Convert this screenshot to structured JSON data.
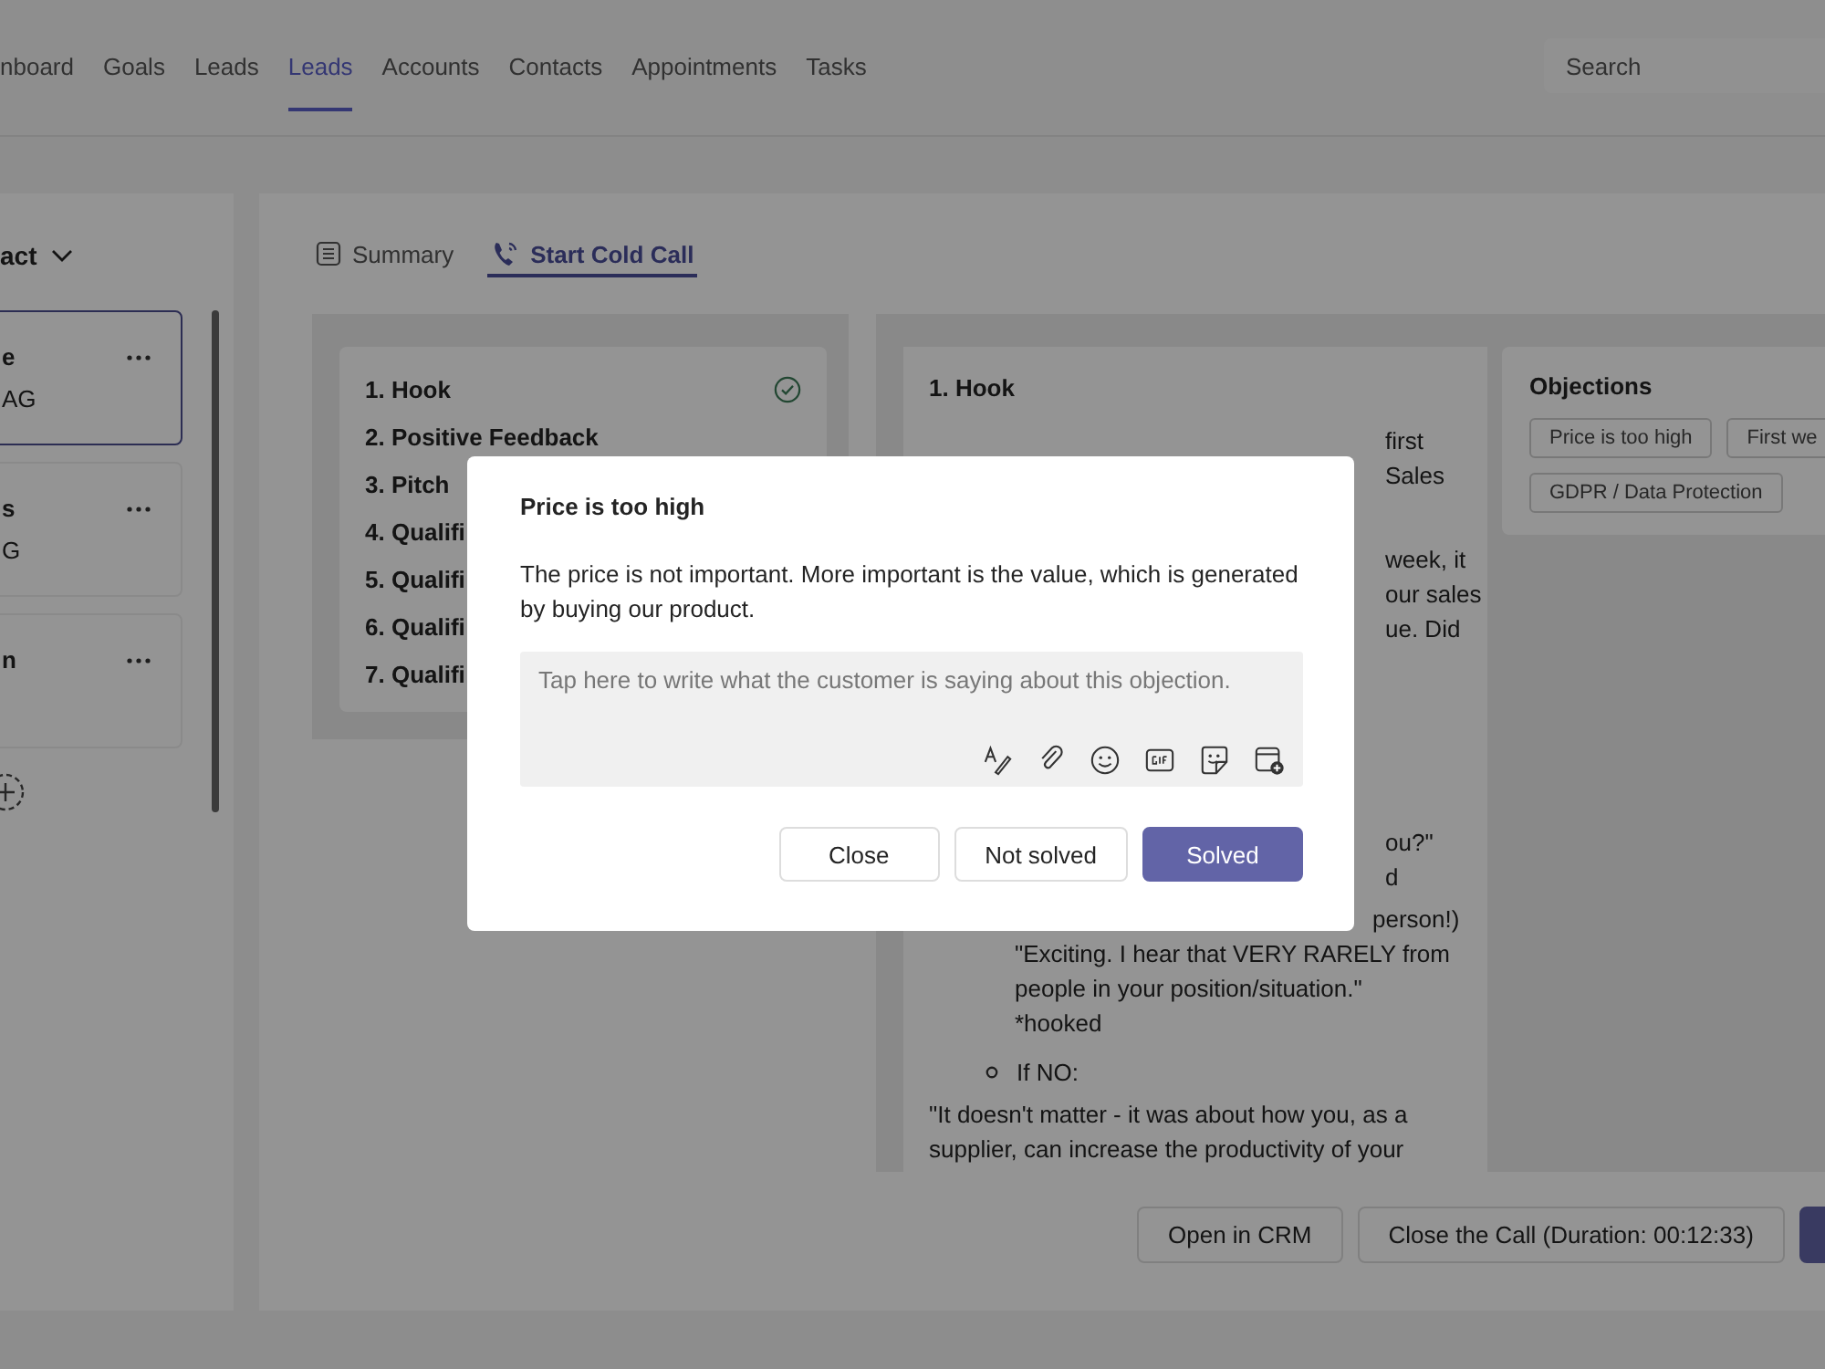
{
  "nav": {
    "tabs": [
      {
        "label": "nboard",
        "selected": false
      },
      {
        "label": "Goals",
        "selected": false
      },
      {
        "label": "Leads",
        "selected": false
      },
      {
        "label": "Leads",
        "selected": true
      },
      {
        "label": "Accounts",
        "selected": false
      },
      {
        "label": "Contacts",
        "selected": false
      },
      {
        "label": "Appointments",
        "selected": false
      },
      {
        "label": "Tasks",
        "selected": false
      }
    ],
    "search": {
      "placeholder": "Search"
    }
  },
  "sidebar": {
    "filter": "act",
    "cards": [
      {
        "title": "e",
        "subtitle": "AG",
        "selected": true
      },
      {
        "title": "s",
        "subtitle": "G",
        "selected": false
      },
      {
        "title": "n",
        "selected": false
      }
    ]
  },
  "view_tabs": [
    {
      "label": "Summary",
      "selected": false
    },
    {
      "label": "Start Cold Call",
      "selected": true
    }
  ],
  "steps": [
    {
      "label": "1. Hook",
      "checked": true
    },
    {
      "label": "2. Positive Feedback",
      "checked": false
    },
    {
      "label": "3. Pitch",
      "checked": false
    },
    {
      "label": "4. Qualifi",
      "checked": false
    },
    {
      "label": "5. Qualifi",
      "checked": false
    },
    {
      "label": "6. Qualifi",
      "checked": false
    },
    {
      "label": "7. Qualifi",
      "checked": false
    }
  ],
  "script": {
    "title": "1. Hook",
    "blocks": [
      {
        "kind": "fragments",
        "lines": [
          "first",
          "Sales"
        ]
      },
      {
        "kind": "fragments",
        "lines": [
          "week, it",
          "our sales",
          "ue. Did"
        ]
      },
      {
        "kind": "fragments",
        "lines": [
          "ou?\"",
          "d"
        ]
      },
      {
        "kind": "tail",
        "text": "person!)"
      },
      {
        "kind": "indented",
        "text": "\"Exciting. I hear that VERY RARELY from people in your position/situation.\" *hooked"
      },
      {
        "kind": "bullet",
        "text": "If NO:"
      },
      {
        "kind": "text",
        "text": "\"It doesn't matter - it was about how you, as a supplier, can increase the productivity of your"
      }
    ]
  },
  "objections": {
    "title": "Objections",
    "chips": [
      "Price is too high",
      "First we",
      "GDPR / Data Protection"
    ]
  },
  "footer_buttons": [
    {
      "label": "Open in CRM",
      "kind": "outline"
    },
    {
      "label": "Close the Call (Duration: 00:12:33)",
      "kind": "outline"
    },
    {
      "kind": "primary"
    }
  ],
  "dialog": {
    "title": "Price is too high",
    "body": "The price is not important. More important is the value, which is generated by buying our product.",
    "note": {
      "placeholder": "Tap here to write what the customer is saying about this objection."
    },
    "buttons": [
      {
        "label": "Close",
        "kind": "default"
      },
      {
        "label": "Not solved",
        "kind": "default"
      },
      {
        "label": "Solved",
        "kind": "primary"
      }
    ]
  }
}
